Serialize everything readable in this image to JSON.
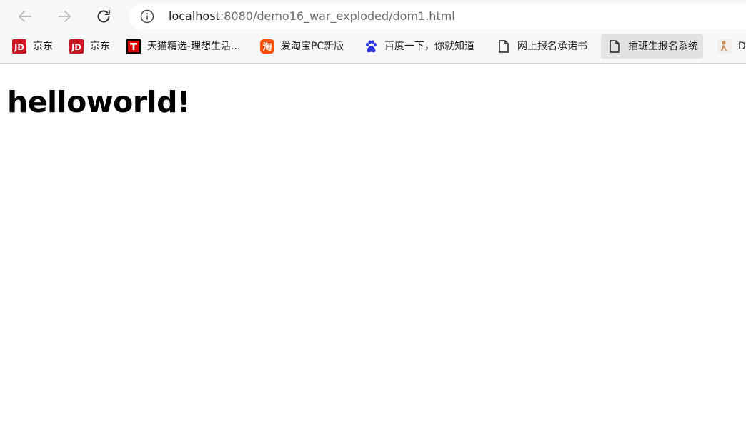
{
  "browser": {
    "url": {
      "host": "localhost",
      "rest": ":8080/demo16_war_exploded/dom1.html"
    },
    "icons": {
      "back": "arrow-left-icon",
      "forward": "arrow-right-icon",
      "refresh": "refresh-icon",
      "info": "info-icon"
    },
    "bookmarks": [
      {
        "label": "京东",
        "icon": "jd-icon",
        "color": "#c81623"
      },
      {
        "label": "京东",
        "icon": "jd-icon",
        "color": "#c81623"
      },
      {
        "label": "天猫精选-理想生活...",
        "icon": "tmall-icon",
        "color": "#e00000"
      },
      {
        "label": "爱淘宝PC新版",
        "icon": "taobao-icon",
        "color": "#ff5000"
      },
      {
        "label": "百度一下，你就知道",
        "icon": "baidu-paw-icon",
        "color": "#2932e1"
      },
      {
        "label": "网上报名承诺书",
        "icon": "document-icon",
        "color": "#333333"
      },
      {
        "label": "插班生报名系统",
        "icon": "document-icon",
        "color": "#333333",
        "active": true
      },
      {
        "label": "D",
        "icon": "figure-icon",
        "color": "#c48a5a"
      }
    ]
  },
  "page": {
    "heading": "helloworld!"
  }
}
